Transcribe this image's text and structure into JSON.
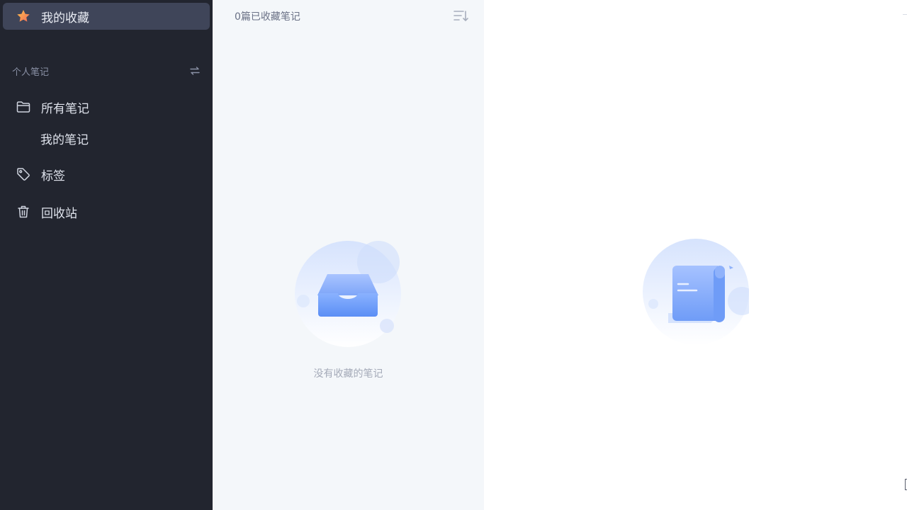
{
  "sidebar": {
    "favorites": {
      "label": "我的收藏",
      "icon": "star-icon"
    },
    "section_title": "个人笔记",
    "nav": {
      "all_notes": {
        "label": "所有笔记",
        "icon": "folder-icon"
      },
      "my_notes": {
        "label": "我的笔记"
      },
      "tags": {
        "label": "标签",
        "icon": "tag-icon"
      },
      "trash": {
        "label": "回收站",
        "icon": "trash-icon"
      }
    }
  },
  "list": {
    "count_label": "0篇已收藏笔记",
    "empty_text": "没有收藏的笔记"
  },
  "colors": {
    "sidebar_bg": "#22252f",
    "active_bg": "#3f4559",
    "list_bg": "#f4f7fa",
    "accent": "#5b8ef5",
    "star": "#f5a623"
  }
}
